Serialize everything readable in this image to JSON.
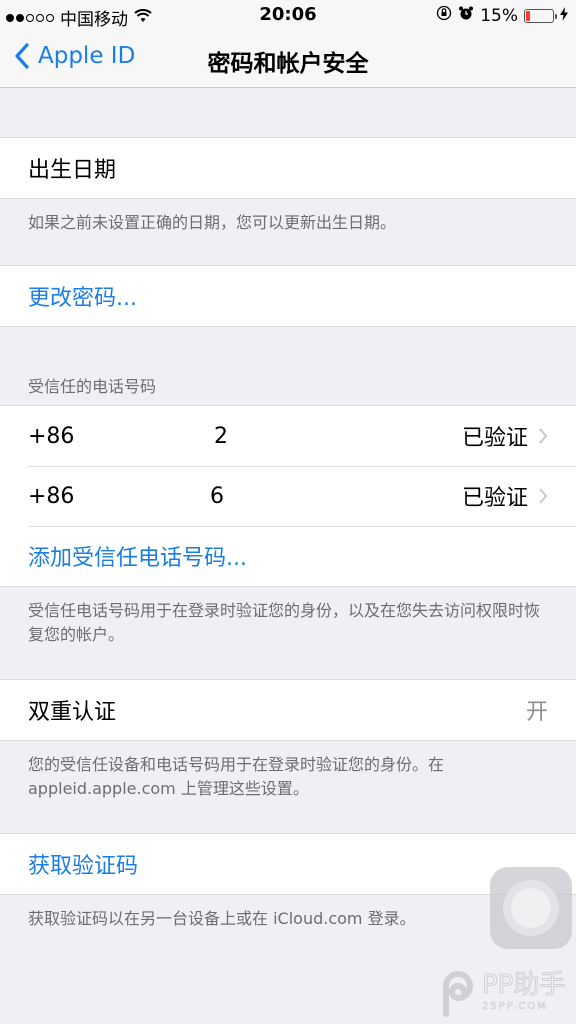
{
  "status_bar": {
    "signal_strength": 2,
    "signal_total": 5,
    "carrier": "中国移动",
    "time": "20:06",
    "battery_percent": "15%",
    "battery_level": 0.15,
    "icons": [
      "wifi-icon",
      "orientation-lock-icon",
      "alarm-icon",
      "battery-icon",
      "charging-icon"
    ]
  },
  "nav": {
    "back_label": "Apple ID",
    "title": "密码和帐户安全"
  },
  "sections": {
    "birthday": {
      "label": "出生日期",
      "footer": "如果之前未设置正确的日期，您可以更新出生日期。"
    },
    "password": {
      "label": "更改密码..."
    },
    "trusted_phones": {
      "header": "受信任的电话号码",
      "phones": [
        {
          "country_code": "+86",
          "number": "2",
          "status": "已验证"
        },
        {
          "country_code": "+86",
          "number": "6",
          "status": "已验证"
        }
      ],
      "add_label": "添加受信任电话号码...",
      "footer": "受信任电话号码用于在登录时验证您的身份，以及在您失去访问权限时恢复您的帐户。"
    },
    "two_factor": {
      "label": "双重认证",
      "value": "开",
      "footer": "您的受信任设备和电话号码用于在登录时验证您的身份。在 appleid.apple.com 上管理这些设置。"
    },
    "verification_code": {
      "label": "获取验证码",
      "footer": "获取验证码以在另一台设备上或在 iCloud.com 登录。"
    }
  },
  "watermark": {
    "brand": "PP助手",
    "site": "25PP.COM"
  },
  "colors": {
    "accent": "#1a7ee5",
    "background": "#efeff4",
    "footer_text": "#6d6d72",
    "battery_low": "#ff3b30"
  }
}
